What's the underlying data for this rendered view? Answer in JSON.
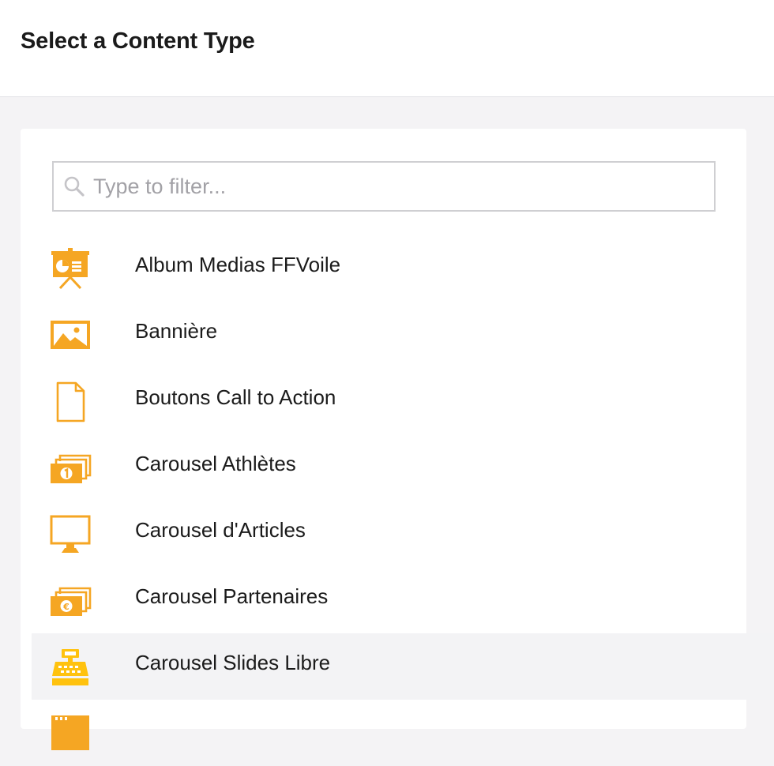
{
  "header": {
    "title": "Select a Content Type"
  },
  "search": {
    "placeholder": "Type to filter...",
    "value": ""
  },
  "colors": {
    "accent": "#f5a623",
    "hover_background": "#f3f3f5"
  },
  "items": [
    {
      "label": "Album Medias FFVoile",
      "icon": "presentation-board-icon"
    },
    {
      "label": "Bannière",
      "icon": "picture-icon"
    },
    {
      "label": "Boutons Call to Action",
      "icon": "document-icon"
    },
    {
      "label": "Carousel Athlètes",
      "icon": "money-stack-icon"
    },
    {
      "label": "Carousel d'Articles",
      "icon": "monitor-icon"
    },
    {
      "label": "Carousel Partenaires",
      "icon": "euro-bills-icon"
    },
    {
      "label": "Carousel Slides Libre",
      "icon": "cash-register-icon"
    },
    {
      "label": "",
      "icon": "calendar-icon"
    }
  ]
}
